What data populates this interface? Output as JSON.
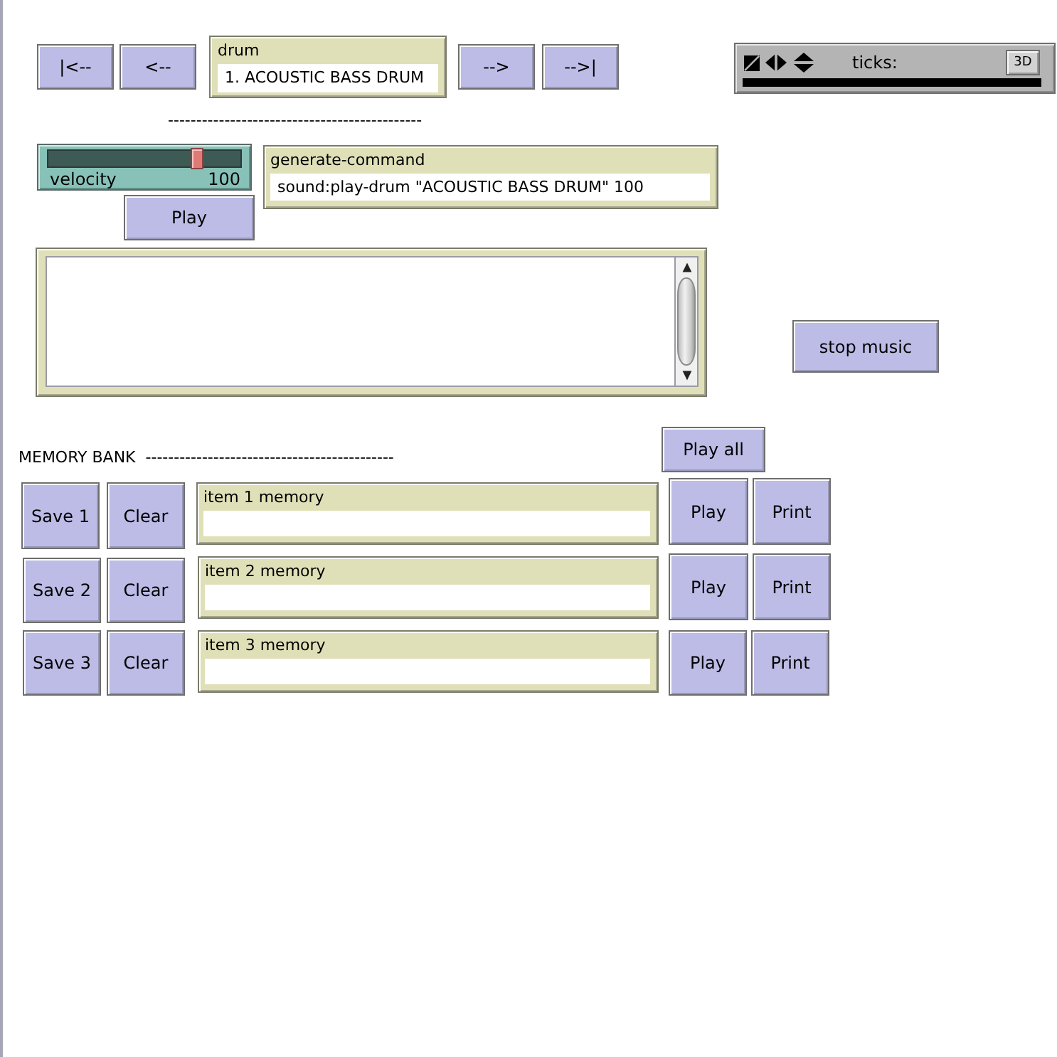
{
  "widgets": [
    {
      "kind": "button",
      "label": "|<--"
    },
    {
      "kind": "button",
      "label": "<--"
    },
    {
      "kind": "chooser",
      "label": "drum",
      "value": "1. ACOUSTIC BASS DRUM"
    },
    {
      "kind": "button",
      "label": "-->"
    },
    {
      "kind": "button",
      "label": "-->|"
    },
    {
      "kind": "tickbar",
      "label": "ticks:",
      "button": "3D"
    },
    {
      "kind": "note",
      "text": "---------------------------------------------"
    },
    {
      "kind": "slider",
      "label": "velocity",
      "reading": "100",
      "level": 0.79
    },
    {
      "kind": "button",
      "label": "Play"
    },
    {
      "kind": "monitor",
      "label": "generate-command",
      "value": "sound:play-drum \"ACOUSTIC BASS DRUM\" 100"
    },
    {
      "kind": "output"
    },
    {
      "kind": "button",
      "label": "stop music"
    },
    {
      "kind": "note",
      "text": "MEMORY BANK  --------------------------------------------"
    },
    {
      "kind": "button",
      "label": "Play all"
    },
    {
      "kind": "button",
      "label": "Save 1"
    },
    {
      "kind": "button",
      "label": "Clear"
    },
    {
      "kind": "monitor",
      "label": "item 1 memory"
    },
    {
      "kind": "button",
      "label": "Play"
    },
    {
      "kind": "button",
      "label": "Print"
    },
    {
      "kind": "button",
      "label": "Save 2"
    },
    {
      "kind": "button",
      "label": "Clear"
    },
    {
      "kind": "monitor",
      "label": "item 2 memory"
    },
    {
      "kind": "button",
      "label": "Play"
    },
    {
      "kind": "button",
      "label": "Print"
    },
    {
      "kind": "button",
      "label": "Save 3"
    },
    {
      "kind": "button",
      "label": "Clear"
    },
    {
      "kind": "monitor",
      "label": "item 3 memory"
    },
    {
      "kind": "button",
      "label": "Play"
    },
    {
      "kind": "button",
      "label": "Print"
    }
  ]
}
